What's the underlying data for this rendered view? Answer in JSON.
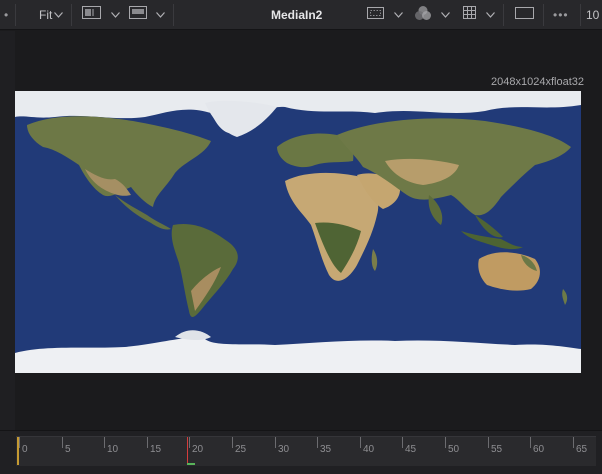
{
  "toolbar": {
    "left_glyph": "•",
    "fit_label": "Fit",
    "title": "MediaIn2",
    "more_glyph": "•••",
    "right_number": "10"
  },
  "viewer": {
    "resolution": "2048x1024xfloat32"
  },
  "timeline": {
    "ticks": [
      "0",
      "5",
      "10",
      "15",
      "20",
      "25",
      "30",
      "35",
      "40",
      "45",
      "50",
      "55",
      "60",
      "65"
    ],
    "current_frame": 20
  },
  "colors": {
    "ocean": "#213a78",
    "land": "#6f7a47",
    "desert": "#b59a6a",
    "ice": "#eef0f3",
    "playhead": "#d43c3c"
  },
  "icons": [
    "fit-dropdown-icon",
    "split-view-icon",
    "display-icon",
    "roi-icon",
    "color-channels-icon",
    "grid-icon",
    "window-icon",
    "more-icon"
  ]
}
